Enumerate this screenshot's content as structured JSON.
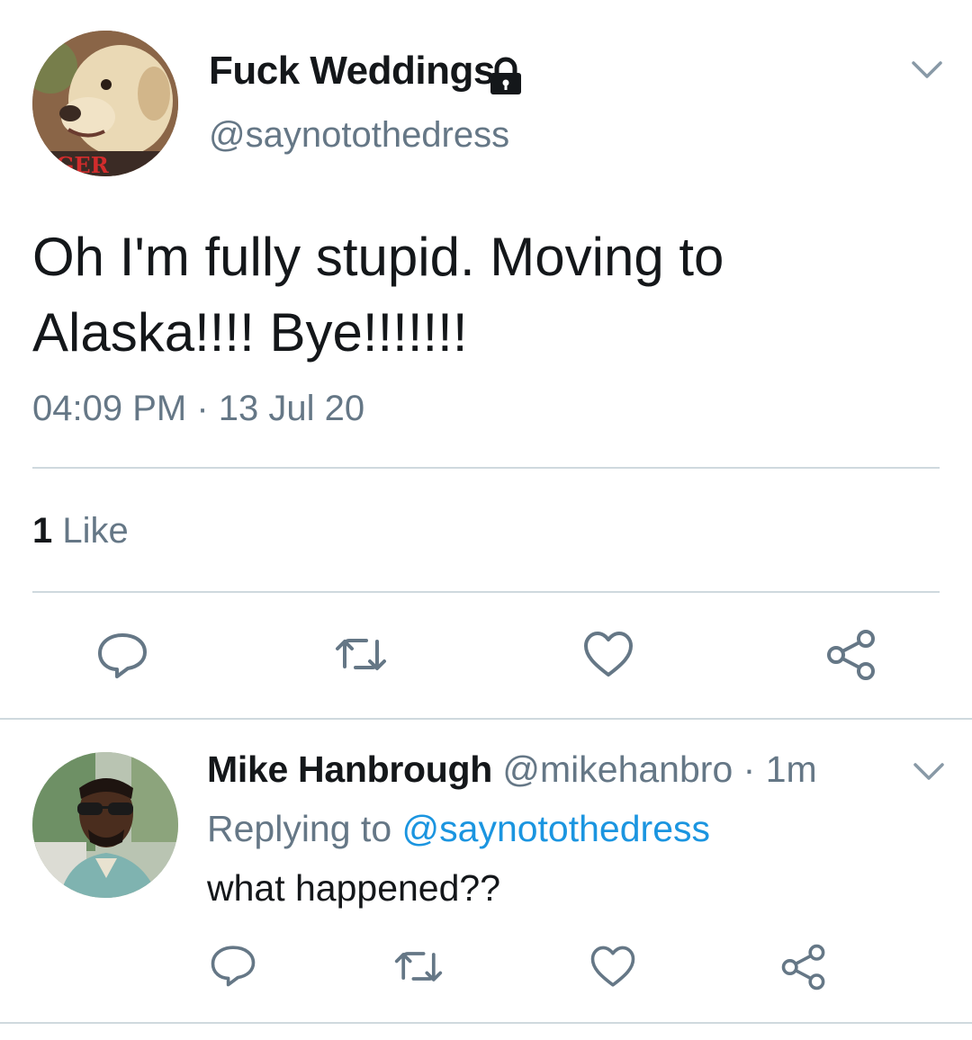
{
  "tweet": {
    "display_name": "Fuck Weddings",
    "handle": "@saynotothedress",
    "avatar_text": "NGER",
    "text_lines": [
      "Oh I'm fully stupid. Moving to",
      "Alaska!!!! Bye!!!!!!!"
    ],
    "timestamp": "04:09 PM · 13 Jul 20",
    "like_count": "1",
    "like_label": "Like"
  },
  "reply": {
    "display_name": "Mike Hanbrough",
    "handle": "@mikehanbro",
    "separator": " · ",
    "time": "1m",
    "replying_prefix": "Replying to ",
    "replying_to": "@saynotothedress",
    "text": "what happened??"
  },
  "icons": {
    "lock": "lock-icon",
    "caret": "chevron-down-icon",
    "reply": "reply-icon",
    "retweet": "retweet-icon",
    "like": "heart-icon",
    "share": "share-icon"
  },
  "colors": {
    "text_primary": "#14171a",
    "text_secondary": "#657786",
    "link": "#1b95e0",
    "divider": "#cfd9de"
  }
}
